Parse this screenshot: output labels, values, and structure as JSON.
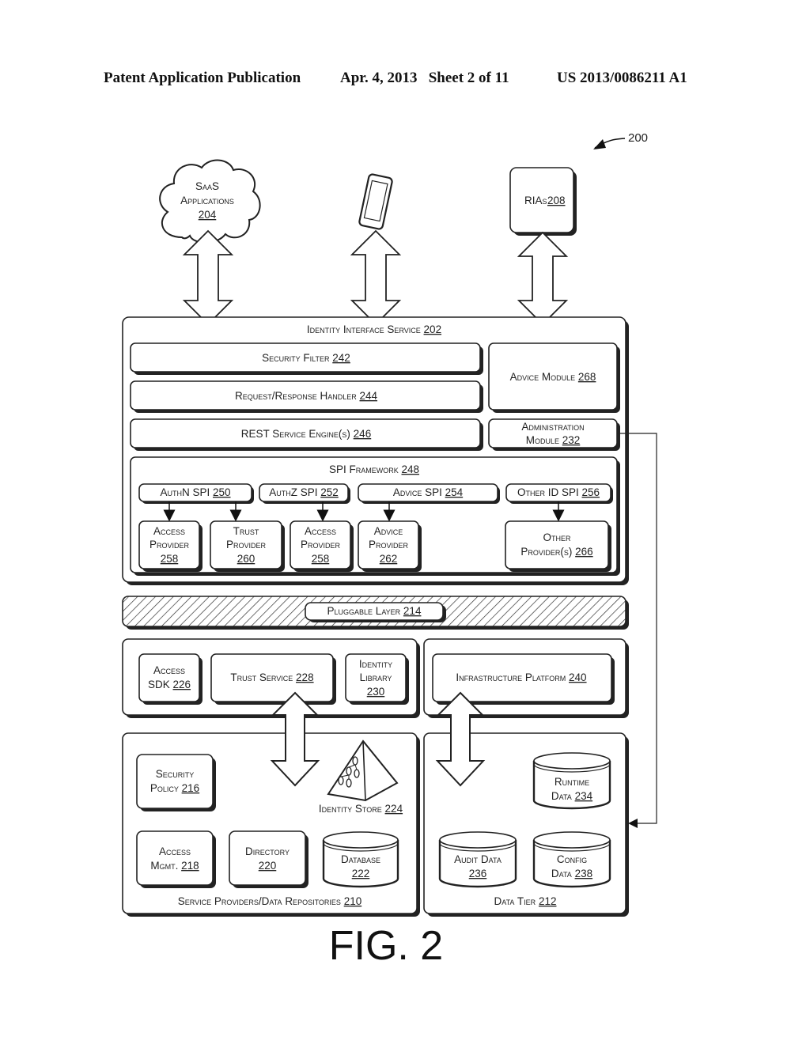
{
  "header": {
    "publication": "Patent Application Publication",
    "date_sheet": "Apr. 4, 2013   Sheet 2 of 11",
    "patent_number": "US 2013/0086211 A1"
  },
  "figure_ref": "200",
  "figure_caption": "FIG. 2",
  "clients": {
    "saas": {
      "line1": "SaaS",
      "line2": "Applications",
      "num": "204"
    },
    "tablet": {
      "icon": "tablet-device-icon"
    },
    "rias": {
      "text": "RIAs",
      "num": "208"
    }
  },
  "identity_interface": {
    "title": "Identity Interface Service",
    "num": "202",
    "security_filter": {
      "text": "Security Filter",
      "num": "242"
    },
    "request_handler": {
      "text": "Request/Response Handler",
      "num": "244"
    },
    "rest_engine": {
      "text": "REST Service Engine(s)",
      "num": "246"
    },
    "advice_module": {
      "text": "Advice Module",
      "num": "268"
    },
    "admin_module": {
      "line1": "Administration",
      "line2": "Module",
      "num": "232"
    },
    "spi_framework": {
      "title": "SPI Framework",
      "num": "248",
      "spis": [
        {
          "text": "AuthN SPI",
          "num": "250"
        },
        {
          "text": "AuthZ SPI",
          "num": "252"
        },
        {
          "text": "Advice SPI",
          "num": "254"
        },
        {
          "text": "Other ID SPI",
          "num": "256"
        }
      ],
      "providers": [
        {
          "line1": "Access",
          "line2": "Provider",
          "num": "258"
        },
        {
          "line1": "Trust",
          "line2": "Provider",
          "num": "260"
        },
        {
          "line1": "Access",
          "line2": "Provider",
          "num": "258"
        },
        {
          "line1": "Advice",
          "line2": "Provider",
          "num": "262"
        },
        {
          "line1": "Other",
          "line2": "Provider(s)",
          "num": "266"
        }
      ]
    }
  },
  "pluggable_layer": {
    "text": "Pluggable Layer",
    "num": "214"
  },
  "middle_left": {
    "access_sdk": {
      "line1": "Access",
      "line2": "SDK",
      "num": "226"
    },
    "trust_service": {
      "text": "Trust Service",
      "num": "228"
    },
    "identity_library": {
      "line1": "Identity",
      "line2": "Library",
      "num": "230"
    }
  },
  "middle_right": {
    "infrastructure": {
      "text": "Infrastructure Platform",
      "num": "240"
    }
  },
  "service_providers": {
    "title": "Service Providers/Data Repositories",
    "num": "210",
    "security_policy": {
      "line1": "Security",
      "line2": "Policy",
      "num": "216"
    },
    "identity_store": {
      "text": "Identity Store",
      "num": "224"
    },
    "access_mgmt": {
      "line1": "Access",
      "line2": "Mgmt.",
      "num": "218"
    },
    "directory": {
      "line1": "Directory",
      "num": "220"
    },
    "database": {
      "line1": "Database",
      "num": "222"
    }
  },
  "data_tier": {
    "title": "Data Tier",
    "num": "212",
    "runtime": {
      "line1": "Runtime",
      "line2": "Data",
      "num": "234"
    },
    "audit": {
      "line1": "Audit Data",
      "num": "236"
    },
    "config": {
      "line1": "Config",
      "line2": "Data",
      "num": "238"
    }
  }
}
